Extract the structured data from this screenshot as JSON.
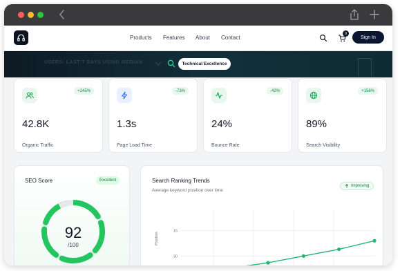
{
  "browser": {
    "back_icon": "chevron-left-icon",
    "share_icon": "share-icon",
    "new_tab_icon": "plus-icon"
  },
  "nav": {
    "logo_icon": "headphones-icon",
    "links": [
      "Products",
      "Features",
      "About",
      "Contact"
    ],
    "cart_count": "0",
    "sign_in": "Sign In"
  },
  "hero": {
    "text": "USERS: LAST 7 DAYS USING MEDIAN",
    "pill": "Technical Excellence"
  },
  "stats": [
    {
      "icon": "users-icon",
      "badge": "+245%",
      "value": "42.8K",
      "label": "Organic Traffic"
    },
    {
      "icon": "lightning-icon",
      "badge": "-73%",
      "value": "1.3s",
      "label": "Page Load Time"
    },
    {
      "icon": "activity-icon",
      "badge": "-42%",
      "value": "24%",
      "label": "Bounce Rate"
    },
    {
      "icon": "globe-icon",
      "badge": "+156%",
      "value": "89%",
      "label": "Search Visibility"
    }
  ],
  "seo": {
    "title": "SEO Score",
    "badge": "Excellent",
    "score": "92",
    "max": "/100",
    "fraction": 0.92
  },
  "ranking": {
    "title": "Search Ranking Trends",
    "subtitle": "Average keyword position over time",
    "badge": "Improving"
  },
  "chart_data": {
    "type": "line",
    "title": "Search Ranking Trends",
    "subtitle": "Average keyword position over time",
    "ylabel": "Position",
    "y_ticks": [
      "15",
      "30"
    ],
    "ylim": [
      0,
      45
    ],
    "y_reversed": true,
    "series": [
      {
        "values": [
          44,
          40,
          37,
          34,
          30,
          26,
          21
        ]
      }
    ],
    "colors": {
      "line": "#22b573",
      "grid": "#e5e7eb"
    }
  },
  "colors": {
    "accent_green": "#22c55e",
    "badge_bg": "#e8f7ee",
    "dark_navy": "#0b1630"
  }
}
